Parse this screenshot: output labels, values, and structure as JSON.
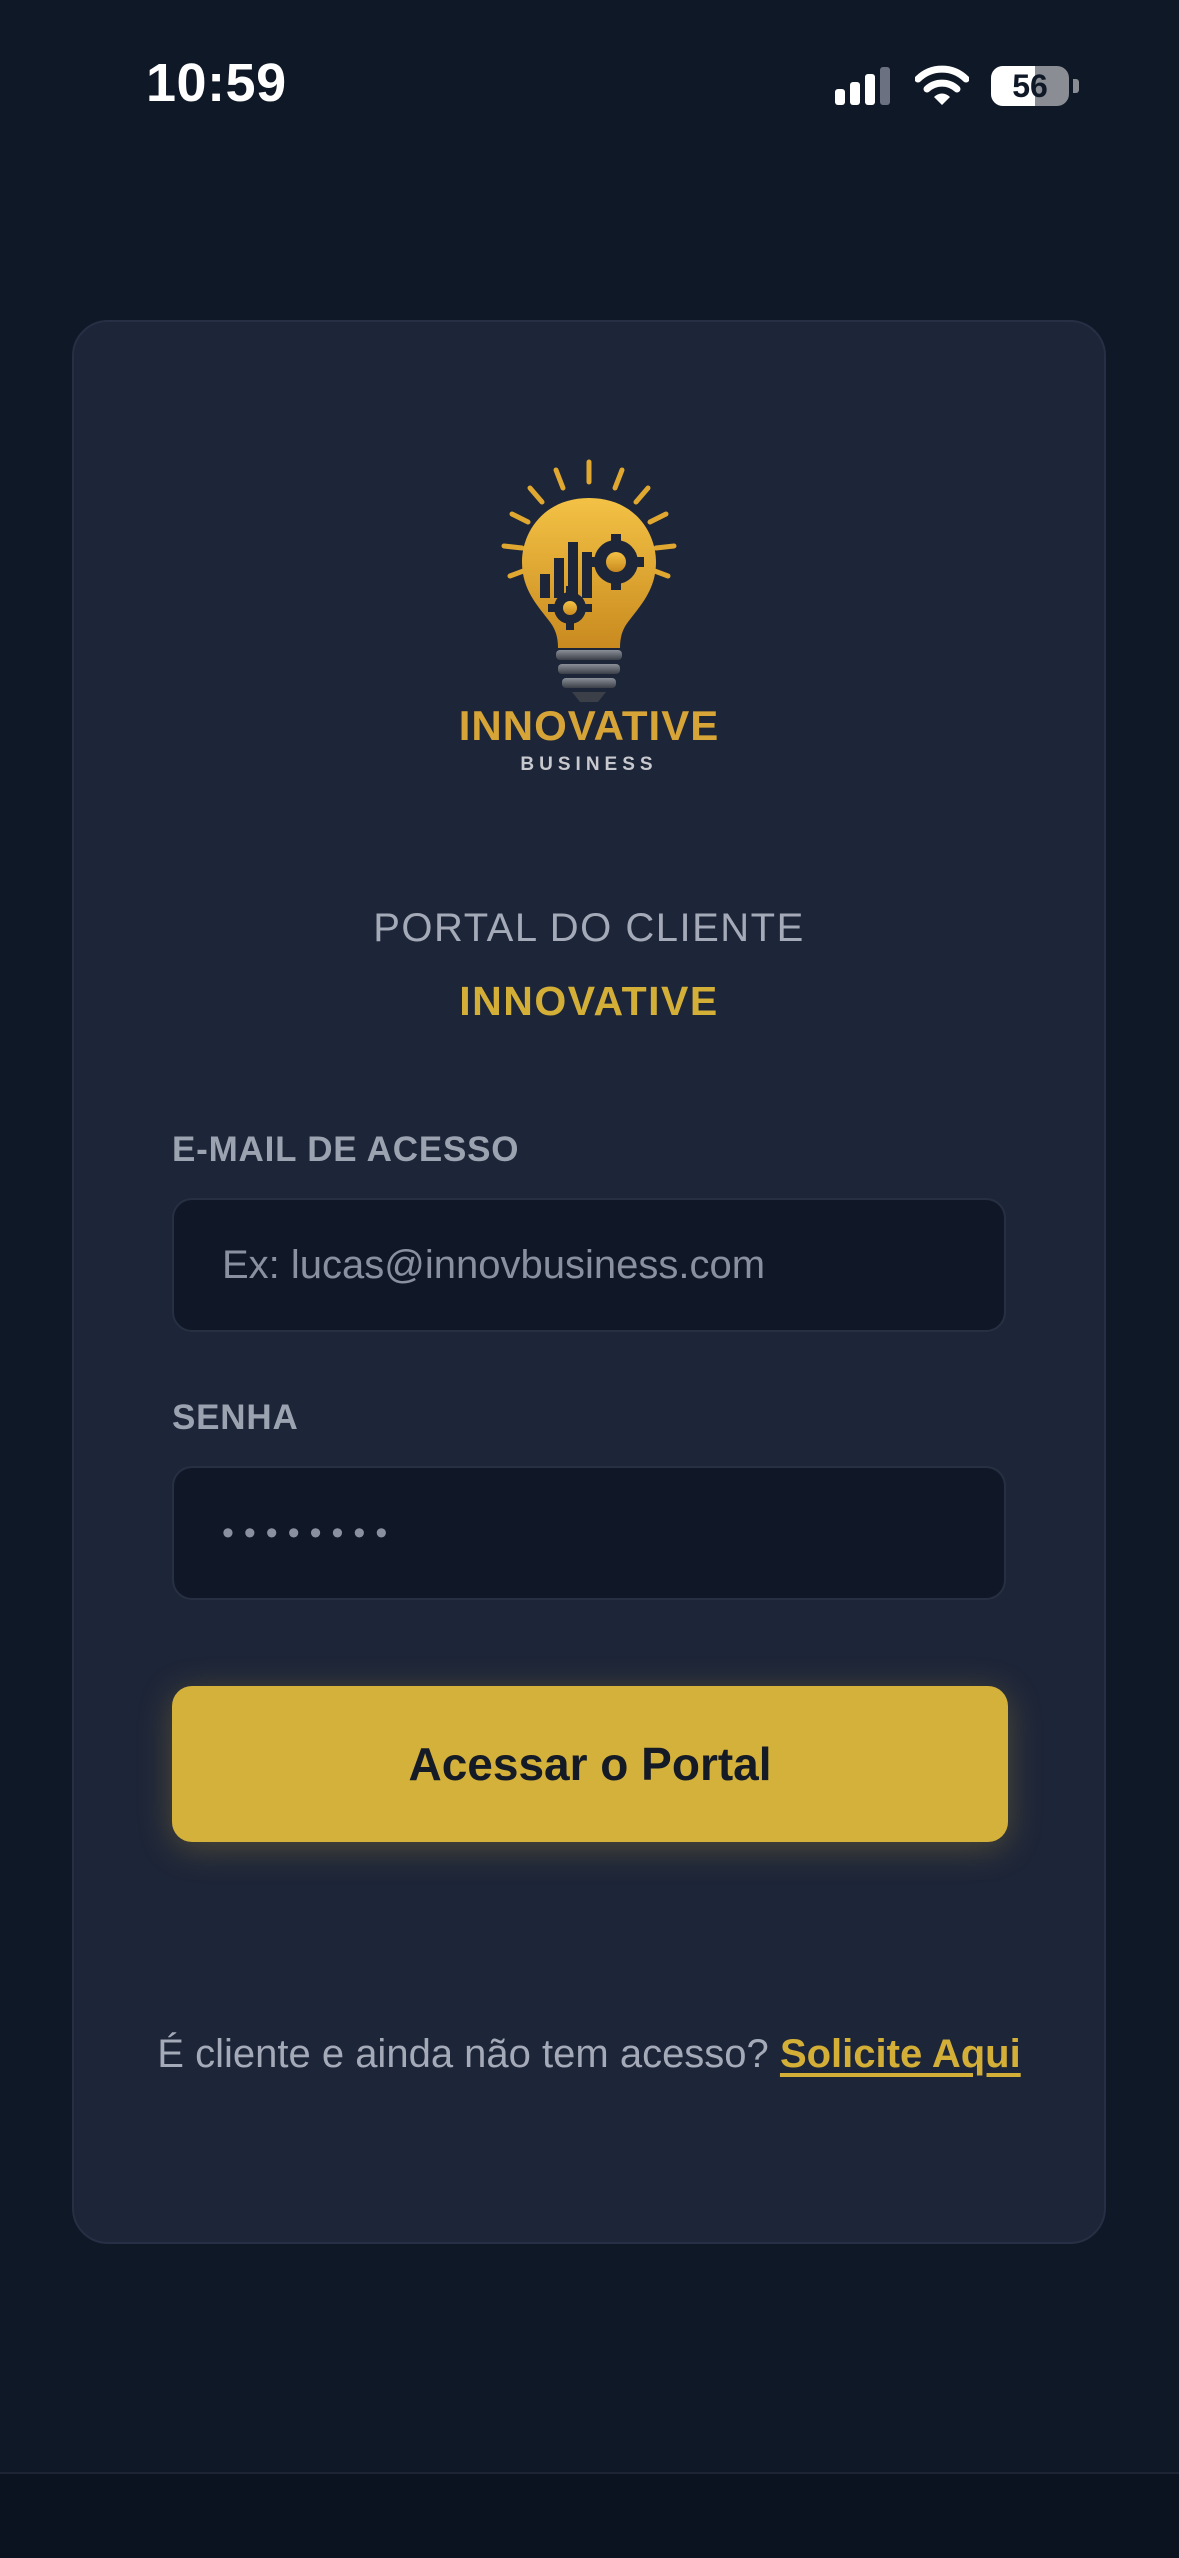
{
  "status_bar": {
    "time": "10:59",
    "battery": "56",
    "battery_level": 0.56
  },
  "brand": {
    "logo_text": "INNOVATIVE",
    "logo_subtext": "BUSINESS",
    "accent_color": "#d4af37"
  },
  "header": {
    "title": "PORTAL DO CLIENTE",
    "subtitle": "INNOVATIVE"
  },
  "form": {
    "email_label": "E-MAIL DE ACESSO",
    "email_placeholder": "Ex: lucas@innovbusiness.com",
    "password_label": "SENHA",
    "password_masked": "••••••••",
    "submit_label": "Acessar o Portal"
  },
  "footer": {
    "signup_prompt": "É cliente e ainda não tem acesso?",
    "signup_link": "Solicite Aqui"
  },
  "colors": {
    "background": "#0f1827",
    "card": "#1d2538",
    "input_bg": "#101828",
    "button": "#d4b13a"
  }
}
